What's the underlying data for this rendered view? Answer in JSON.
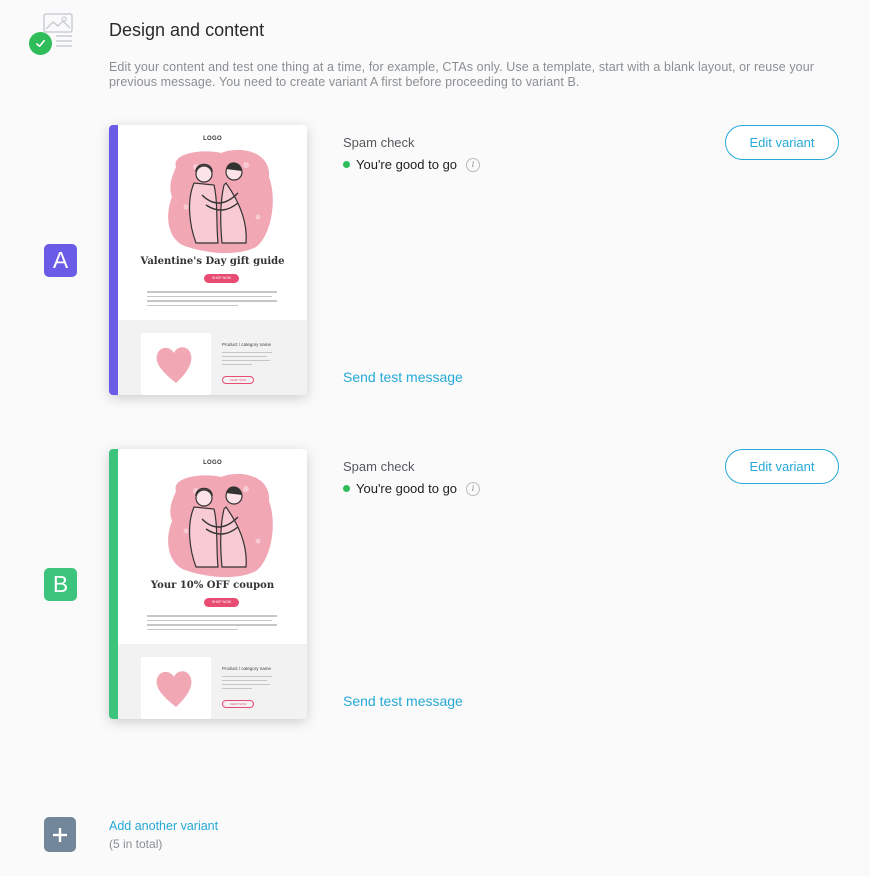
{
  "section": {
    "title": "Design and content",
    "description": "Edit your content and test one thing at a time, for example, CTAs only. Use a template, start with a blank layout, or reuse your previous message. You need to create variant A first before proceeding to variant B."
  },
  "variants": [
    {
      "badge": "A",
      "color": "#6b5ce7",
      "preview": {
        "logo": "LOGO",
        "headline": "Valentine's Day gift guide",
        "button": "SHOP NOW",
        "product_title": "Product / category name",
        "product_button": "SHOP NOW"
      },
      "spam_check_label": "Spam check",
      "spam_status": "You're good to go",
      "edit_label": "Edit variant",
      "send_test_label": "Send test message"
    },
    {
      "badge": "B",
      "color": "#3cc47c",
      "preview": {
        "logo": "LOGO",
        "headline": "Your 10% OFF coupon",
        "button": "SHOP NOW",
        "product_title": "Product / category name",
        "product_button": "SHOP NOW"
      },
      "spam_check_label": "Spam check",
      "spam_status": "You're good to go",
      "edit_label": "Edit variant",
      "send_test_label": "Send test message"
    }
  ],
  "add_variant": {
    "label": "Add another variant",
    "note": "(5 in total)",
    "icon": "plus-icon"
  },
  "icons": {
    "section": "design-content-icon",
    "completed": "check-circle-icon",
    "info": "info-icon"
  },
  "colors": {
    "accent": "#26a9d6",
    "success": "#2ebd59",
    "pink": "#e84c73"
  }
}
